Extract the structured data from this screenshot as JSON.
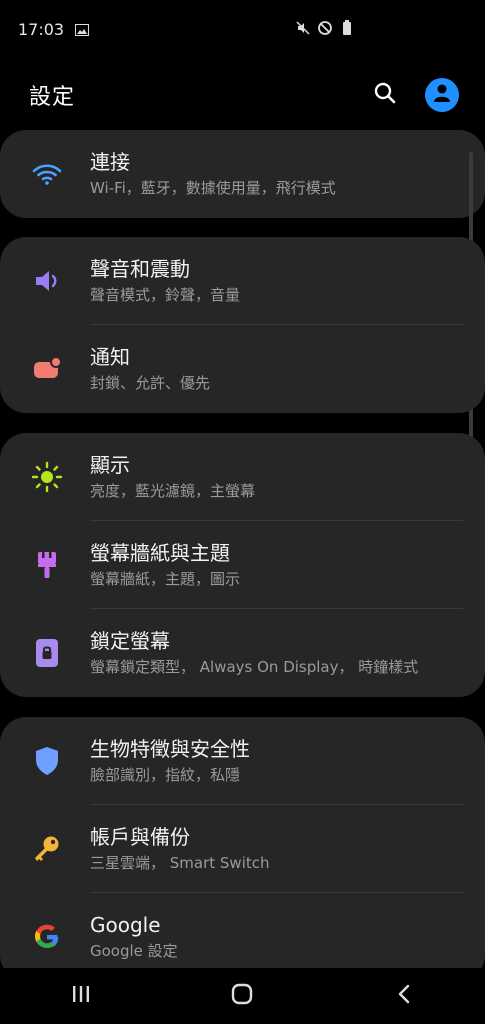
{
  "status": {
    "time": "17:03",
    "icons": [
      "image-icon",
      "mute-icon",
      "do-not-disturb-icon",
      "battery-icon"
    ]
  },
  "header": {
    "title": "設定",
    "search_icon": "search-icon",
    "profile_icon": "profile-icon"
  },
  "groups": [
    {
      "items": [
        {
          "title": "連接",
          "subtitle": "Wi-Fi，藍牙，數據使用量，飛行模式",
          "icon": "wifi-icon",
          "color": "#4aa3ff"
        }
      ]
    },
    {
      "items": [
        {
          "title": "聲音和震動",
          "subtitle": "聲音模式，鈴聲，音量",
          "icon": "volume-icon",
          "color": "#9a7cf7"
        },
        {
          "title": "通知",
          "subtitle": "封鎖、允許、優先",
          "icon": "notification-icon",
          "color": "#f07b6f"
        }
      ]
    },
    {
      "items": [
        {
          "title": "顯示",
          "subtitle": "亮度，藍光濾鏡，主螢幕",
          "icon": "brightness-icon",
          "color": "#b5e61d"
        },
        {
          "title": "螢幕牆紙與主題",
          "subtitle": "螢幕牆紙，主題，圖示",
          "icon": "paint-brush-icon",
          "color": "#c56cf0"
        },
        {
          "title": "鎖定螢幕",
          "subtitle": "螢幕鎖定類型， Always On Display， 時鐘樣式",
          "icon": "lock-screen-icon",
          "color": "#a98bf0"
        }
      ]
    },
    {
      "items": [
        {
          "title": "生物特徵與安全性",
          "subtitle": "臉部識別，指紋，私隱",
          "icon": "shield-icon",
          "color": "#6fa0ff"
        },
        {
          "title": "帳戶與備份",
          "subtitle": "三星雲端， Smart Switch",
          "icon": "key-icon",
          "color": "#f5b437"
        },
        {
          "title": "Google",
          "subtitle": "Google 設定",
          "icon": "google-icon",
          "color": "#4285f4"
        }
      ]
    }
  ],
  "navbar": {
    "recents": "recents-icon",
    "home": "home-icon",
    "back": "back-icon"
  }
}
